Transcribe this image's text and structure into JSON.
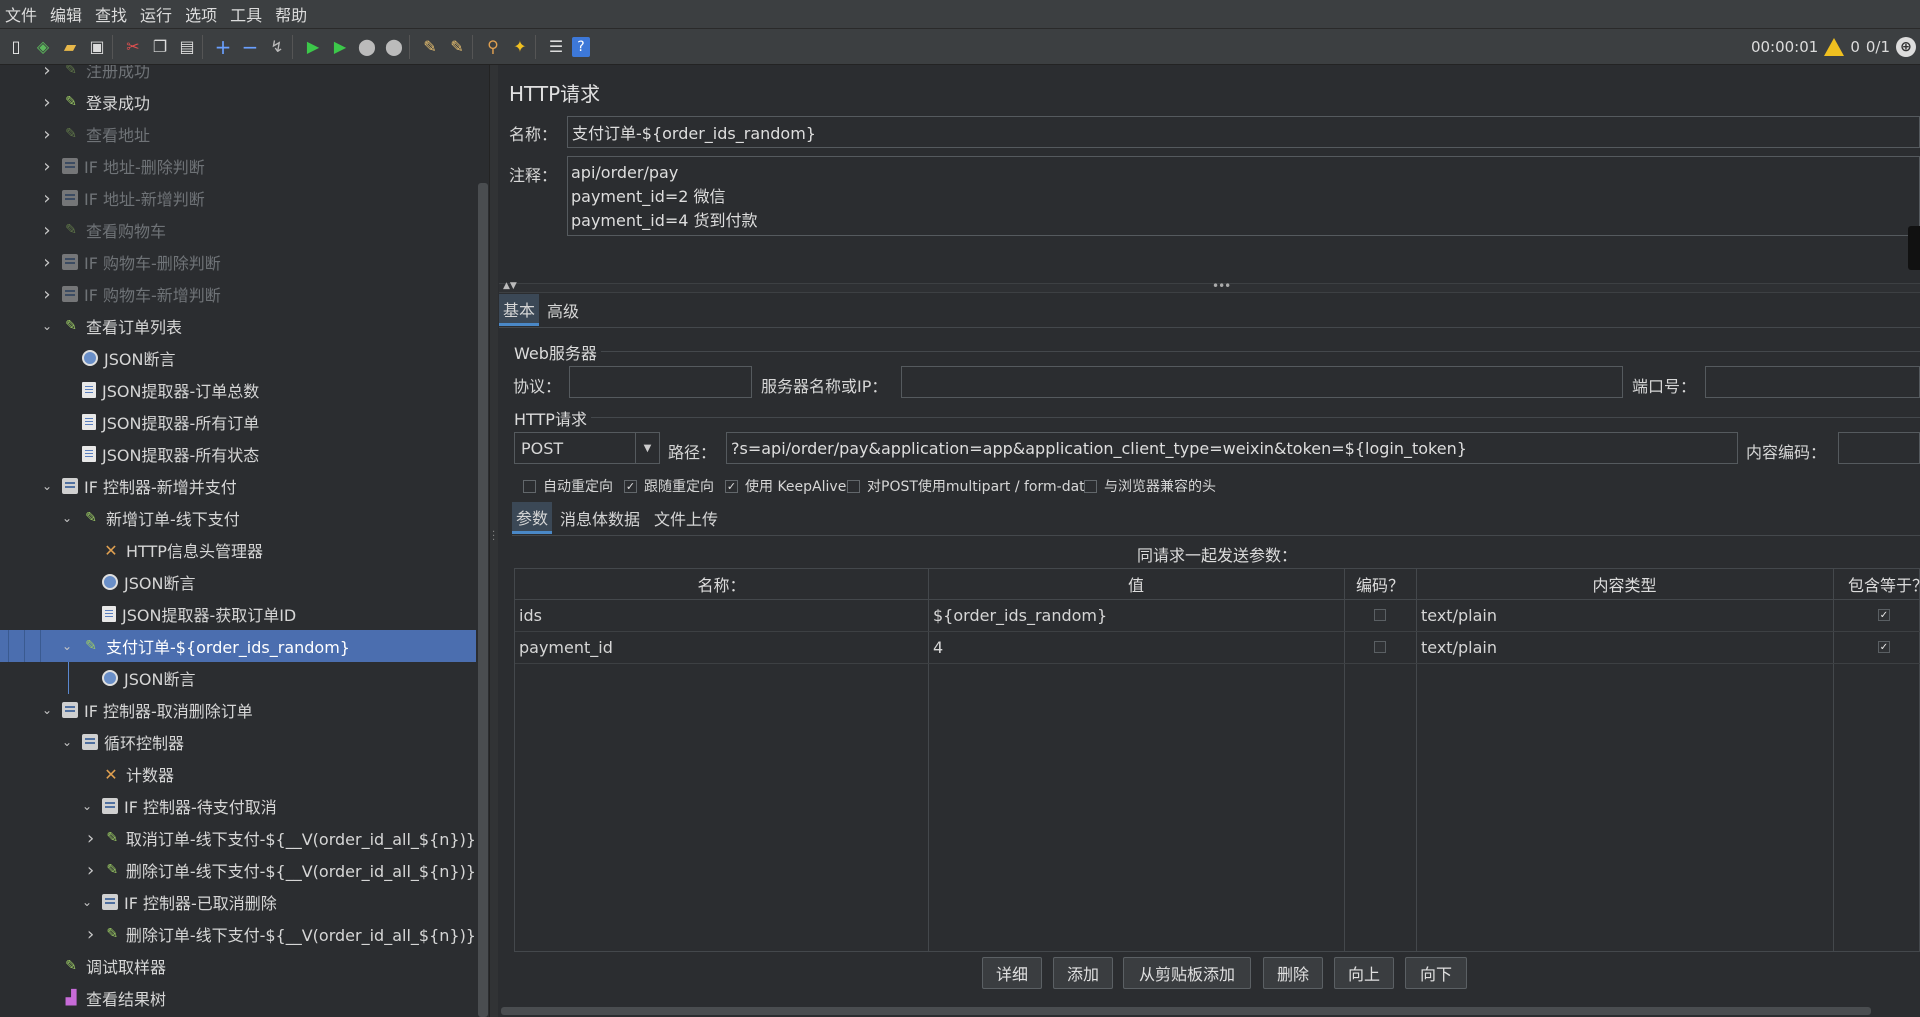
{
  "menu": [
    "文件",
    "编辑",
    "查找",
    "运行",
    "选项",
    "工具",
    "帮助"
  ],
  "toolbar": {
    "timer": "00:00:01",
    "warnings": "0",
    "threads": "0/1"
  },
  "tree": [
    {
      "label": "注册成功",
      "icon": "sampler",
      "indent": 1,
      "chev": "right",
      "disabled": true
    },
    {
      "label": "登录成功",
      "icon": "sampler",
      "indent": 1,
      "chev": "right",
      "disabled": false
    },
    {
      "label": "查看地址",
      "icon": "sampler",
      "indent": 1,
      "chev": "right",
      "disabled": true
    },
    {
      "label": "IF 地址-删除判断",
      "icon": "controller",
      "indent": 1,
      "chev": "right",
      "disabled": true
    },
    {
      "label": "IF 地址-新增判断",
      "icon": "controller",
      "indent": 1,
      "chev": "right",
      "disabled": true
    },
    {
      "label": "查看购物车",
      "icon": "sampler",
      "indent": 1,
      "chev": "right",
      "disabled": true
    },
    {
      "label": "IF 购物车-删除判断",
      "icon": "controller",
      "indent": 1,
      "chev": "right",
      "disabled": true
    },
    {
      "label": "IF 购物车-新增判断",
      "icon": "controller",
      "indent": 1,
      "chev": "right",
      "disabled": true
    },
    {
      "label": "查看订单列表",
      "icon": "sampler",
      "indent": 1,
      "chev": "down",
      "disabled": false
    },
    {
      "label": "JSON断言",
      "icon": "assert",
      "indent": 2,
      "chev": "",
      "disabled": false
    },
    {
      "label": "JSON提取器-订单总数",
      "icon": "extractor",
      "indent": 2,
      "chev": "",
      "disabled": false
    },
    {
      "label": "JSON提取器-所有订单",
      "icon": "extractor",
      "indent": 2,
      "chev": "",
      "disabled": false
    },
    {
      "label": "JSON提取器-所有状态",
      "icon": "extractor",
      "indent": 2,
      "chev": "",
      "disabled": false
    },
    {
      "label": "IF 控制器-新增并支付",
      "icon": "controller",
      "indent": 1,
      "chev": "down",
      "disabled": false
    },
    {
      "label": "新增订单-线下支付",
      "icon": "sampler",
      "indent": 2,
      "chev": "down",
      "disabled": false
    },
    {
      "label": "HTTP信息头管理器",
      "icon": "tool",
      "indent": 3,
      "chev": "",
      "disabled": false
    },
    {
      "label": "JSON断言",
      "icon": "assert",
      "indent": 3,
      "chev": "",
      "disabled": false
    },
    {
      "label": "JSON提取器-获取订单ID",
      "icon": "extractor",
      "indent": 3,
      "chev": "",
      "disabled": false
    },
    {
      "label": "支付订单-${order_ids_random}",
      "icon": "sampler",
      "indent": 2,
      "chev": "down",
      "disabled": false,
      "selected": true
    },
    {
      "label": "JSON断言",
      "icon": "assert",
      "indent": 3,
      "chev": "",
      "disabled": false
    },
    {
      "label": "IF 控制器-取消删除订单",
      "icon": "controller",
      "indent": 1,
      "chev": "down",
      "disabled": false
    },
    {
      "label": "循环控制器",
      "icon": "controller",
      "indent": 2,
      "chev": "down",
      "disabled": false
    },
    {
      "label": "计数器",
      "icon": "tool",
      "indent": 3,
      "chev": "",
      "disabled": false
    },
    {
      "label": "IF 控制器-待支付取消",
      "icon": "controller",
      "indent": 3,
      "chev": "down",
      "disabled": false
    },
    {
      "label": "取消订单-线下支付-${__V(order_id_all_${n})}",
      "icon": "sampler",
      "indent": 4,
      "chev": "right",
      "disabled": false
    },
    {
      "label": "删除订单-线下支付-${__V(order_id_all_${n})}",
      "icon": "sampler",
      "indent": 4,
      "chev": "right",
      "disabled": false
    },
    {
      "label": "IF 控制器-已取消删除",
      "icon": "controller",
      "indent": 3,
      "chev": "down",
      "disabled": false
    },
    {
      "label": "删除订单-线下支付-${__V(order_id_all_${n})}",
      "icon": "sampler",
      "indent": 4,
      "chev": "right",
      "disabled": false
    },
    {
      "label": "调试取样器",
      "icon": "sampler",
      "indent": 1,
      "chev": "",
      "disabled": false
    },
    {
      "label": "查看结果树",
      "icon": "chart",
      "indent": 1,
      "chev": "",
      "disabled": false
    }
  ],
  "panel": {
    "title": "HTTP请求",
    "name_label": "名称：",
    "name_value": "支付订单-${order_ids_random}",
    "comment_label": "注释：",
    "comment_lines": [
      "api/order/pay",
      "payment_id=2 微信",
      "payment_id=4 货到付款"
    ],
    "tabs": [
      "基本",
      "高级"
    ],
    "web_server_title": "Web服务器",
    "protocol_label": "协议：",
    "protocol_value": "",
    "server_label": "服务器名称或IP：",
    "server_value": "",
    "port_label": "端口号：",
    "port_value": "",
    "http_request_title": "HTTP请求",
    "method": "POST",
    "path_label": "路径：",
    "path_value": "?s=api/order/pay&application=app&application_client_type=weixin&token=${login_token}",
    "encoding_label": "内容编码：",
    "encoding_value": "",
    "checkboxes": [
      {
        "label": "自动重定向",
        "checked": false
      },
      {
        "label": "跟随重定向",
        "checked": true
      },
      {
        "label": "使用 KeepAlive",
        "checked": true
      },
      {
        "label": "对POST使用multipart / form-data",
        "checked": false
      },
      {
        "label": "与浏览器兼容的头",
        "checked": false
      }
    ],
    "subtabs": [
      "参数",
      "消息体数据",
      "文件上传"
    ],
    "table_caption": "同请求一起发送参数：",
    "columns": [
      "名称：",
      "值",
      "编码？",
      "内容类型",
      "包含等于？"
    ],
    "rows": [
      {
        "name": "ids",
        "value": "${order_ids_random}",
        "encode": false,
        "content_type": "text/plain",
        "include_equals": true
      },
      {
        "name": "payment_id",
        "value": "4",
        "encode": false,
        "content_type": "text/plain",
        "include_equals": true
      }
    ],
    "buttons": [
      "详细",
      "添加",
      "从剪贴板添加",
      "删除",
      "向上",
      "向下"
    ]
  }
}
